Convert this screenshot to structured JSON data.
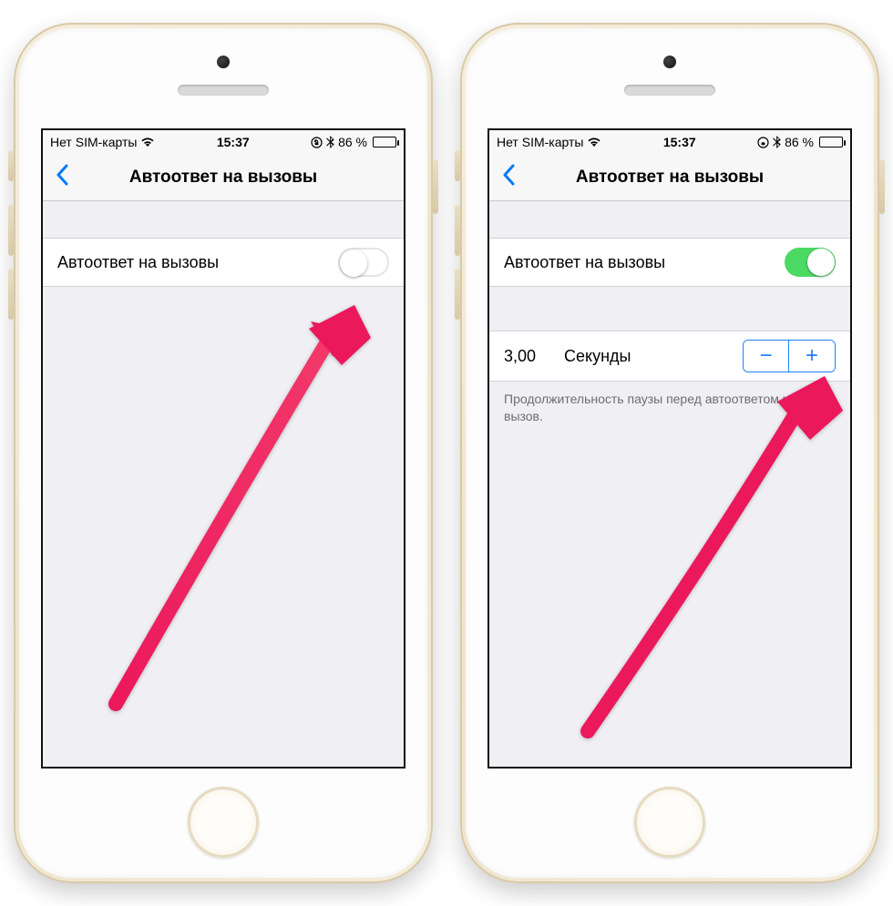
{
  "status": {
    "carrier": "Нет SIM-карты",
    "time": "15:37",
    "battery_pct": "86 %"
  },
  "nav": {
    "title": "Автоответ на вызовы"
  },
  "left_screen": {
    "auto_answer_label": "Автоответ на вызовы",
    "toggle_on": false
  },
  "right_screen": {
    "auto_answer_label": "Автоответ на вызовы",
    "toggle_on": true,
    "seconds_value": "3,00",
    "seconds_unit": "Секунды",
    "footer": "Продолжительность паузы перед автоответом на вызов."
  },
  "icons": {
    "minus": "−",
    "plus": "+"
  },
  "colors": {
    "accent": "#007aff",
    "toggle_on": "#4cd964",
    "arrow": "#ec185c"
  }
}
